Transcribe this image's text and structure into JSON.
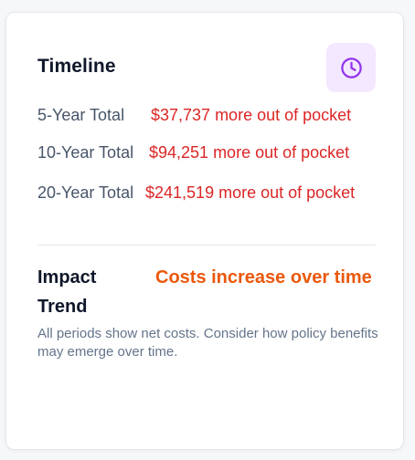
{
  "card": {
    "title": "Timeline",
    "icon": "clock-icon",
    "accent_color": "#9333ea",
    "icon_bg_color": "#f3e8ff",
    "rows": [
      {
        "label": "5-Year Total",
        "value": "$37,737 more out of pocket"
      },
      {
        "label": "10-Year Total",
        "value": "$94,251 more out of pocket"
      },
      {
        "label": "20-Year Total",
        "value": "$241,519 more out of pocket"
      }
    ],
    "value_color": "#dc2626",
    "impact": {
      "label": "Impact Trend",
      "value": "Costs increase over time",
      "color": "#ea580c"
    },
    "note": "All periods show net costs. Consider how policy benefits may emerge over time."
  }
}
